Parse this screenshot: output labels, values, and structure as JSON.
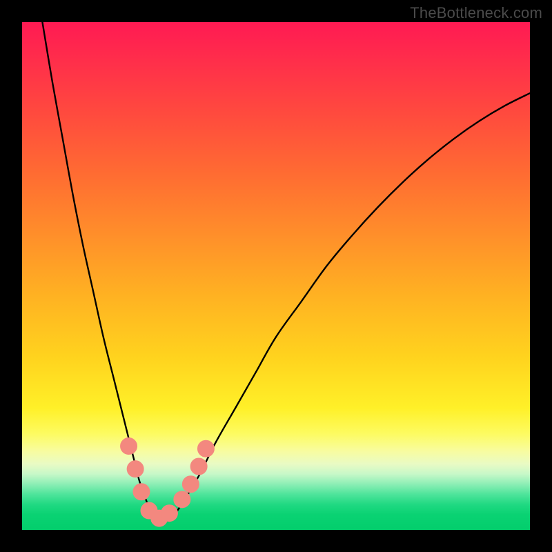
{
  "attribution": "TheBottleneck.com",
  "colors": {
    "background": "#000000",
    "gradient_top": "#ff1a53",
    "gradient_mid": "#ffd31e",
    "gradient_bottom": "#03ce6c",
    "curve_stroke": "#000000",
    "marker_fill": "#f3887f",
    "marker_stroke": "#f3887f"
  },
  "chart_data": {
    "type": "line",
    "title": "",
    "xlabel": "",
    "ylabel": "",
    "xlim": [
      0,
      100
    ],
    "ylim": [
      0,
      100
    ],
    "series": [
      {
        "name": "bottleneck-curve",
        "x": [
          4,
          6,
          8,
          10,
          12,
          14,
          16,
          18,
          20,
          21,
          22,
          23,
          24,
          25,
          26,
          27,
          28,
          29,
          30,
          32,
          35,
          38,
          42,
          46,
          50,
          55,
          60,
          65,
          70,
          75,
          80,
          85,
          90,
          95,
          100
        ],
        "y": [
          100,
          88,
          77,
          66,
          56,
          47,
          38,
          30,
          22,
          18,
          14,
          10,
          7,
          4.5,
          3,
          2.2,
          2,
          2.2,
          3,
          6,
          11,
          17,
          24,
          31,
          38,
          45,
          52,
          58,
          63.5,
          68.5,
          73,
          77,
          80.5,
          83.5,
          86
        ]
      }
    ],
    "markers": [
      {
        "x": 21.0,
        "y": 16.5
      },
      {
        "x": 22.3,
        "y": 12.0
      },
      {
        "x": 23.5,
        "y": 7.5
      },
      {
        "x": 25.0,
        "y": 3.8
      },
      {
        "x": 27.0,
        "y": 2.3
      },
      {
        "x": 29.0,
        "y": 3.3
      },
      {
        "x": 31.5,
        "y": 6.0
      },
      {
        "x": 33.2,
        "y": 9.0
      },
      {
        "x": 34.8,
        "y": 12.5
      },
      {
        "x": 36.2,
        "y": 16.0
      }
    ],
    "marker_radius_px": 12
  }
}
